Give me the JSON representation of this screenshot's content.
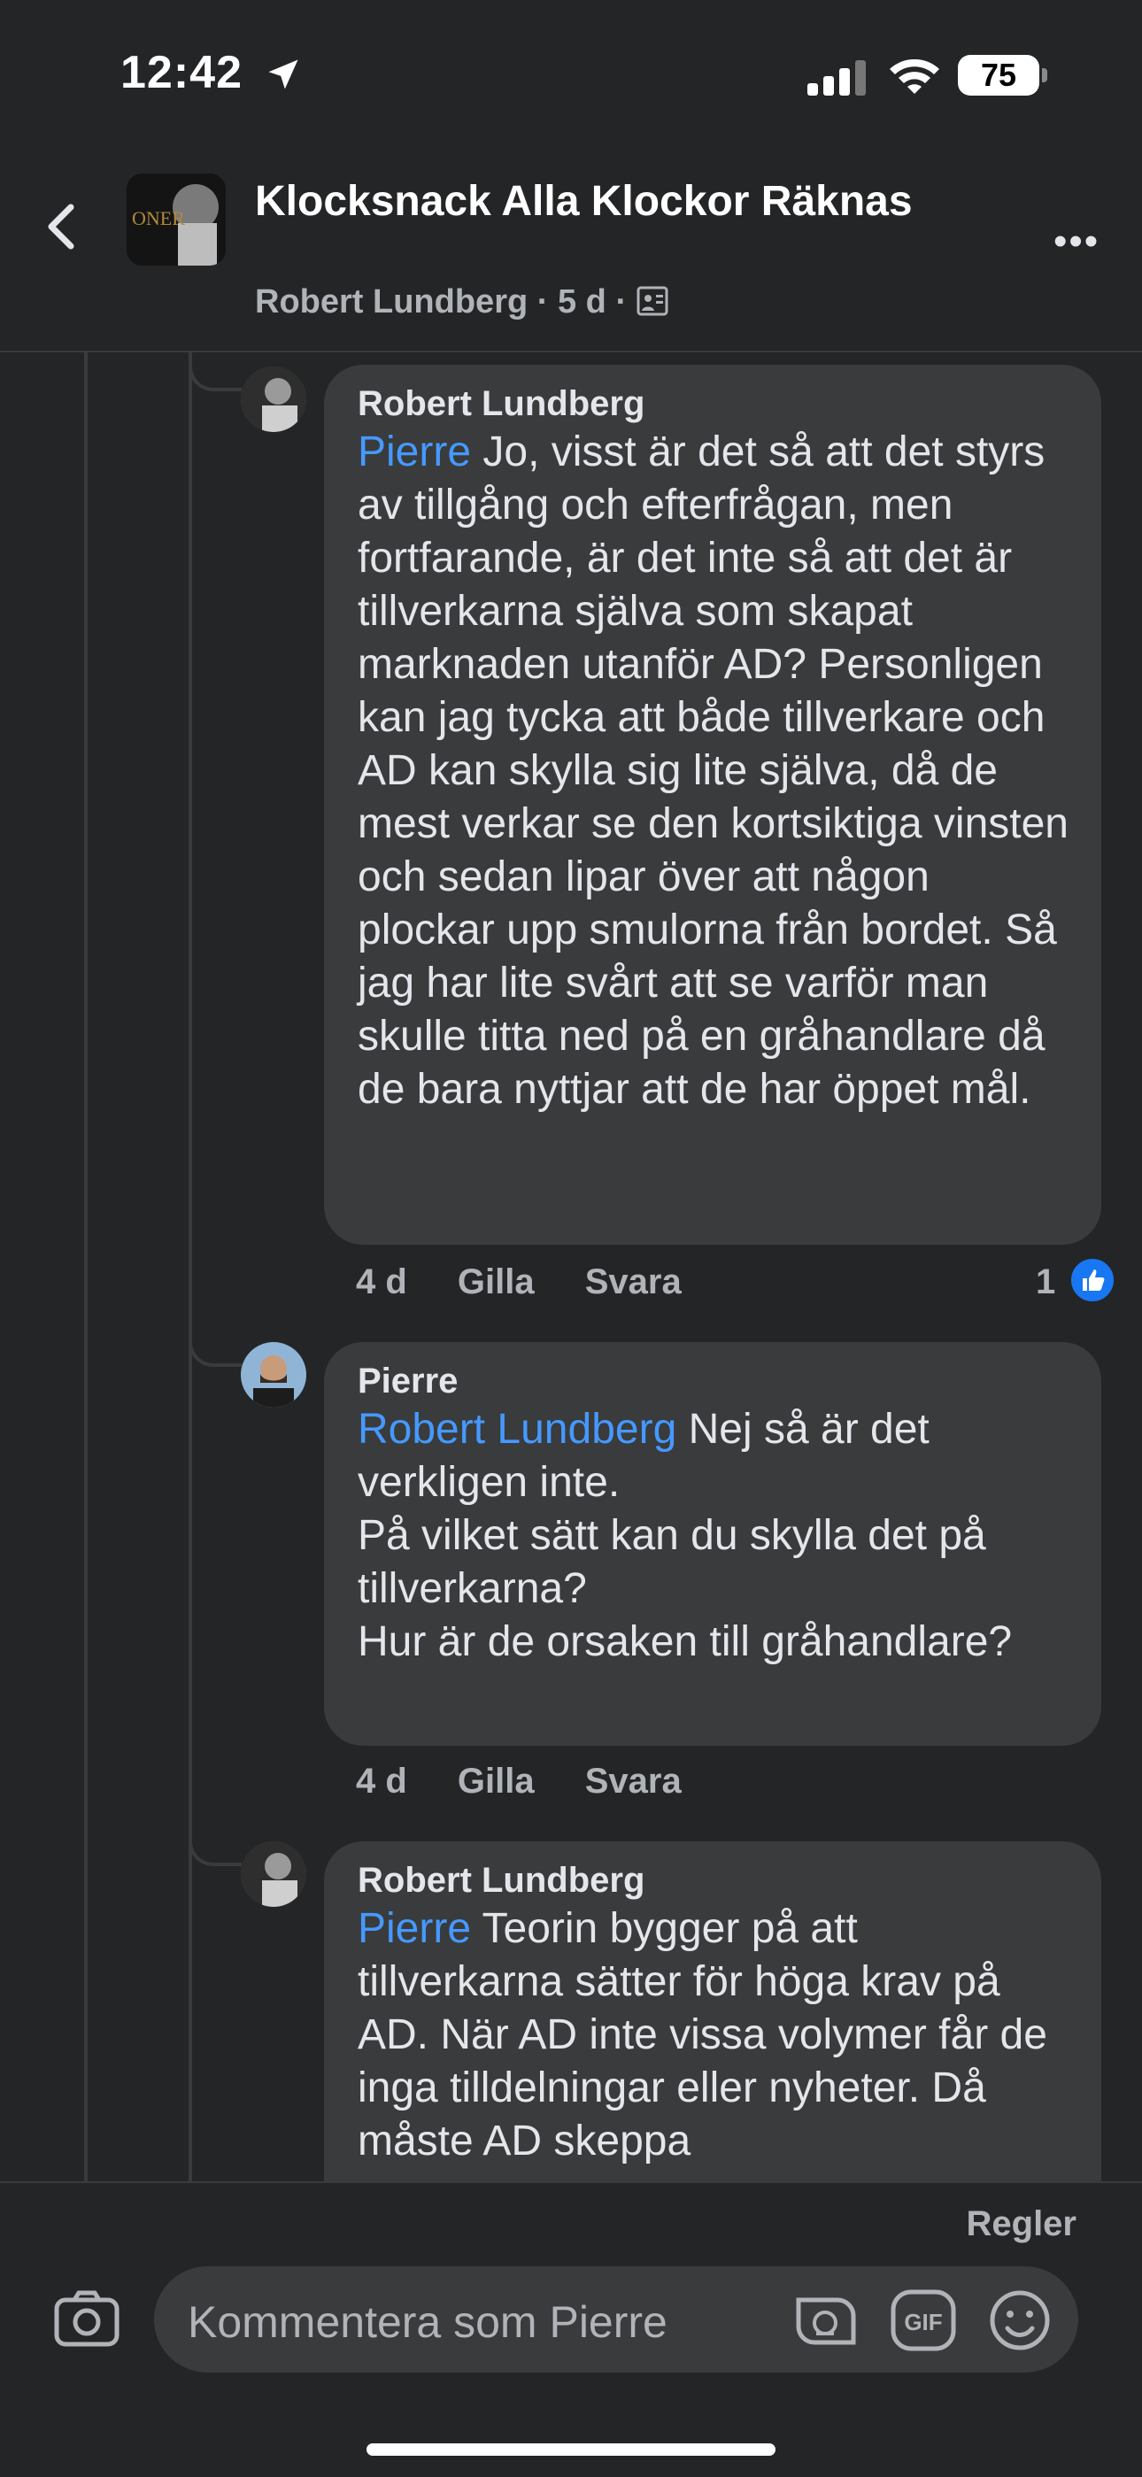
{
  "status": {
    "time": "12:42",
    "battery": "75"
  },
  "header": {
    "group_title": "Klocksnack Alla Klockor Räknas",
    "author": "Robert Lundberg",
    "age": "5 d",
    "icons": [
      "back-chevron-icon",
      "group-icon",
      "more-icon",
      "audience-icon"
    ]
  },
  "comments": [
    {
      "author": "Robert Lundberg",
      "mention": "Pierre",
      "text": " Jo, visst är det så att det styrs av tillgång och efterfrågan, men fortfarande, är det inte så att det är tillverkarna själva som skapat marknaden utanför AD? Personligen kan jag tycka att både tillverkare och AD kan skylla sig lite själva, då de mest verkar se den kortsiktiga vinsten och sedan lipar över att någon plockar upp smulorna från bordet. Så jag har lite svårt att se varför man skulle titta ned på en gråhandlare då de bara nyttjar att de har öppet mål.",
      "age": "4 d",
      "like": "Gilla",
      "reply": "Svara",
      "reactions": "1"
    },
    {
      "author": "Pierre",
      "mention": "Robert Lundberg",
      "text": " Nej så är det verkligen inte.\nPå vilket sätt kan du skylla det på tillverkarna?\nHur är de orsaken till gråhandlare?",
      "age": "4 d",
      "like": "Gilla",
      "reply": "Svara"
    },
    {
      "author": "Robert Lundberg",
      "mention": "Pierre",
      "text": " Teorin bygger på att tillverkarna sätter för höga krav på AD. När AD inte vissa volymer får de inga tilldelningar eller nyheter. Då måste AD skeppa",
      "age": "",
      "like": "",
      "reply": ""
    }
  ],
  "footer": {
    "rules": "Regler",
    "placeholder": "Kommentera som Pierre",
    "gif": "GIF"
  },
  "colors": {
    "background": "#242526",
    "bubble": "#3a3b3c",
    "mention": "#4599ff",
    "like": "#1877f2"
  }
}
